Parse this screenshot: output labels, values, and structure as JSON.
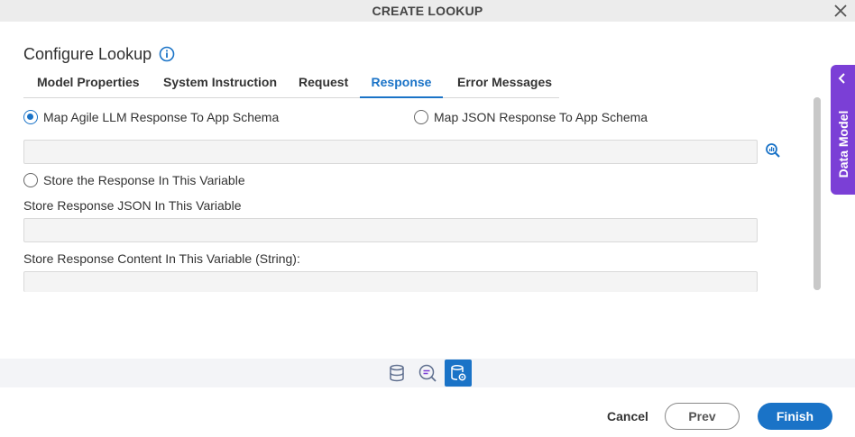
{
  "dialog": {
    "title": "CREATE LOOKUP"
  },
  "header": {
    "heading": "Configure Lookup"
  },
  "tabs": [
    {
      "label": "Model Properties"
    },
    {
      "label": "System Instruction"
    },
    {
      "label": "Request"
    },
    {
      "label": "Response",
      "active": true
    },
    {
      "label": "Error Messages"
    }
  ],
  "response": {
    "option_map_agile": "Map Agile LLM Response To App Schema",
    "option_map_json": "Map JSON Response To App Schema",
    "selected_option": "Map Agile LLM Response To App Schema",
    "schema_field_value": "",
    "option_store_response": "Store the Response In This Variable",
    "store_json_label": "Store Response JSON In This Variable",
    "store_json_value": "",
    "store_content_label": "Store Response Content In This Variable (String):",
    "store_content_value": ""
  },
  "side_panel": {
    "label": "Data Model"
  },
  "bottom_toolbar": {
    "icons": [
      "database-icon",
      "chat-search-icon",
      "database-settings-icon"
    ],
    "active": "database-settings-icon"
  },
  "footer": {
    "cancel": "Cancel",
    "prev": "Prev",
    "finish": "Finish"
  },
  "colors": {
    "accent": "#1a73c7",
    "side_panel": "#7b3fd6",
    "titlebar": "#ececec"
  }
}
